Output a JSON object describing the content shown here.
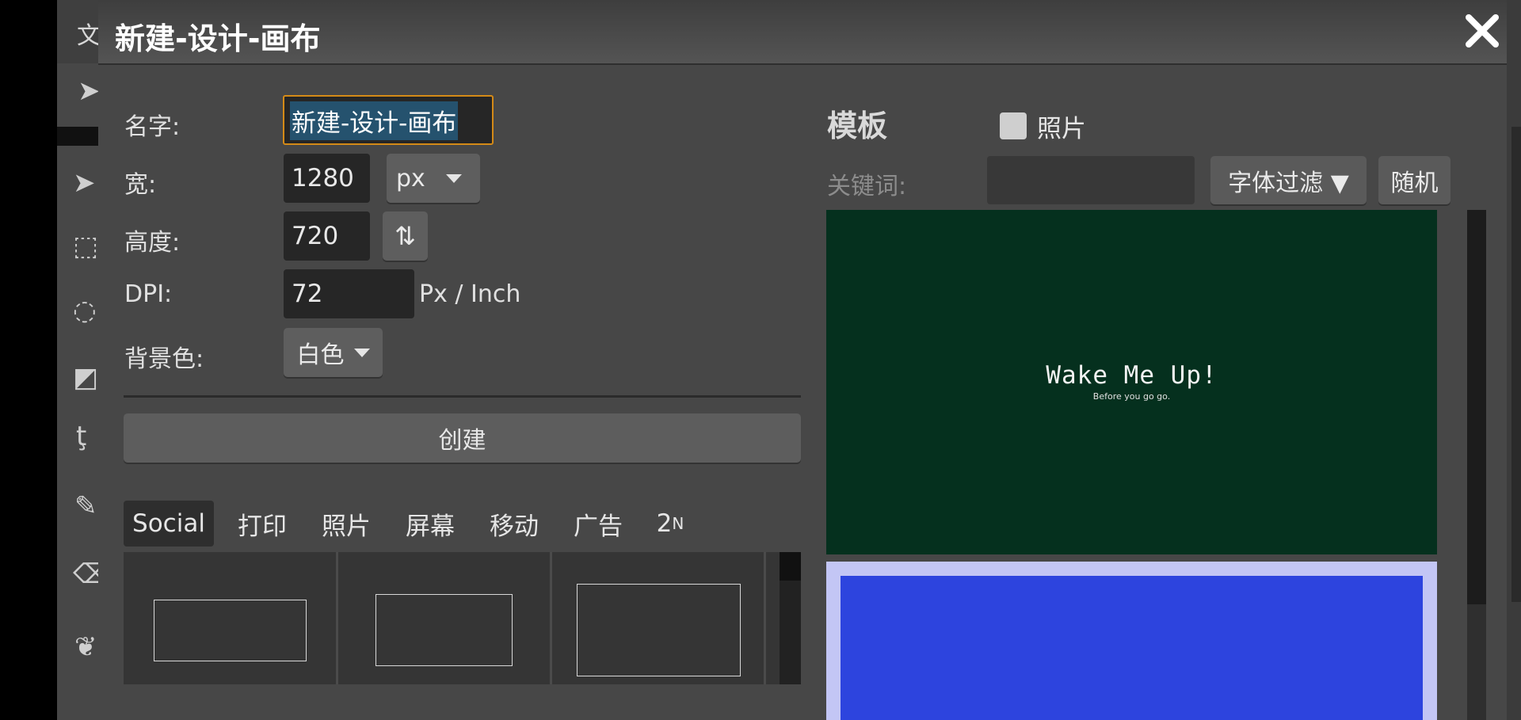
{
  "background_app": {
    "menu_letter": "文",
    "tools": [
      {
        "icon": "cursor-arrow-icon",
        "glyph": "➤"
      },
      {
        "icon": "cursor-arrow-icon",
        "glyph": "➤"
      },
      {
        "icon": "marquee-select-icon",
        "glyph": "⬚"
      },
      {
        "icon": "lasso-icon",
        "glyph": "◌"
      },
      {
        "icon": "magic-select-icon",
        "glyph": "◩"
      },
      {
        "icon": "crop-icon",
        "glyph": "ţ"
      },
      {
        "icon": "pen-icon",
        "glyph": "✎"
      },
      {
        "icon": "eraser-icon",
        "glyph": "⌫"
      },
      {
        "icon": "brush-icon",
        "glyph": "❦"
      }
    ]
  },
  "dialog": {
    "title": "新建-设计-画布",
    "close_glyph": "✕"
  },
  "form": {
    "name_label": "名字:",
    "name_value": "新建-设计-画布",
    "width_label": "宽:",
    "width_value": "1280",
    "unit_value": "px",
    "height_label": "高度:",
    "height_value": "720",
    "swap_glyph": "⇅",
    "dpi_label": "DPI:",
    "dpi_value": "72",
    "dpi_unit": "Px / Inch",
    "bg_label": "背景色:",
    "bg_value": "白色",
    "create_label": "创建"
  },
  "tabs": [
    {
      "label": "Social",
      "selected": true
    },
    {
      "label": "打印",
      "selected": false
    },
    {
      "label": "照片",
      "selected": false
    },
    {
      "label": "屏幕",
      "selected": false
    },
    {
      "label": "移动",
      "selected": false
    },
    {
      "label": "广告",
      "selected": false
    },
    {
      "label": "2",
      "sup": "N",
      "selected": false
    }
  ],
  "templates": {
    "title": "模板",
    "photo_label": "照片",
    "photo_checked": false,
    "keyword_label": "关键词:",
    "keyword_value": "",
    "font_filter_label": "字体过滤 ▼",
    "random_label": "随机",
    "cards": [
      {
        "title": "Wake Me Up!",
        "subtitle": "Before you go go.",
        "bg": "#05301e"
      },
      {
        "bg": "#2d44de",
        "frame": "#c3c6f5"
      }
    ]
  },
  "colors": {
    "dialog_bg": "#474747",
    "accent_focus": "#d48a17",
    "selection": "#25526e"
  }
}
